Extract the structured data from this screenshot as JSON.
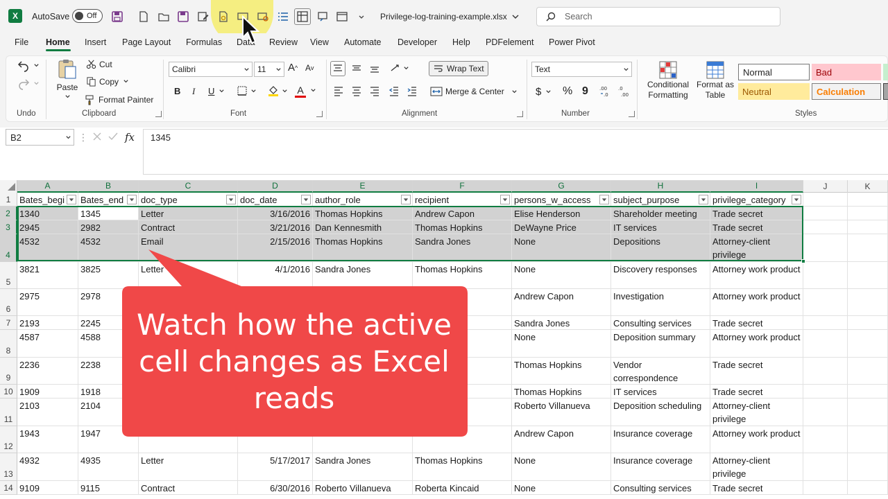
{
  "titlebar": {
    "autosave_label": "AutoSave",
    "autosave_state": "Off",
    "filename": "Privilege-log-training-example.xlsx",
    "search_placeholder": "Search"
  },
  "menu": [
    "File",
    "Home",
    "Insert",
    "Page Layout",
    "Formulas",
    "Data",
    "Review",
    "View",
    "Automate",
    "Developer",
    "Help",
    "PDFelement",
    "Power Pivot"
  ],
  "ribbon": {
    "undo_label": "Undo",
    "clipboard": {
      "paste": "Paste",
      "cut": "Cut",
      "copy": "Copy",
      "format_painter": "Format Painter",
      "label": "Clipboard"
    },
    "font": {
      "name": "Calibri",
      "size": "11",
      "bold": "B",
      "italic": "I",
      "underline": "U",
      "grow": "A",
      "shrink": "A",
      "color_letter": "A",
      "label": "Font"
    },
    "alignment": {
      "wrap_text": "Wrap Text",
      "merge_center": "Merge & Center",
      "label": "Alignment"
    },
    "number": {
      "format": "Text",
      "currency": "$",
      "percent": "%",
      "comma": "9",
      "label": "Number"
    },
    "styles": {
      "conditional_1": "Conditional",
      "conditional_2": "Formatting",
      "format_table_1": "Format as",
      "format_table_2": "Table",
      "normal": "Normal",
      "bad": "Bad",
      "neutral": "Neutral",
      "calculation": "Calculation",
      "label": "Styles"
    }
  },
  "formula_bar": {
    "name_box": "B2",
    "fx": "fx",
    "value": "1345"
  },
  "colors": {
    "excel_green": "#107c41",
    "callout_red": "#f04848",
    "highlight_yellow": "#f5ec64"
  },
  "sheet": {
    "columns": [
      "A",
      "B",
      "C",
      "D",
      "E",
      "F",
      "G",
      "H",
      "I",
      "J",
      "K"
    ],
    "headers": [
      "Bates_begi",
      "Bates_end",
      "doc_type",
      "doc_date",
      "author_role",
      "recipient",
      "persons_w_access",
      "subject_purpose",
      "privilege_category"
    ],
    "rows": [
      {
        "n": "2",
        "cells": [
          "1340",
          "1345",
          "Letter",
          "3/16/2016",
          "Thomas Hopkins",
          "Andrew Capon",
          "Elise Henderson",
          "Shareholder meeting",
          "Trade secret"
        ]
      },
      {
        "n": "3",
        "cells": [
          "2945",
          "2982",
          "Contract",
          "3/21/2016",
          "Dan Kennesmith",
          "Thomas Hopkins",
          "DeWayne Price",
          "IT services",
          "Trade secret"
        ]
      },
      {
        "n": "4",
        "cells": [
          "4532",
          "4532",
          "Email",
          "2/15/2016",
          "Thomas Hopkins",
          "Sandra Jones",
          "None",
          "Depositions",
          "Attorney-client privilege"
        ]
      },
      {
        "n": "5",
        "cells": [
          "3821",
          "3825",
          "Letter",
          "4/1/2016",
          "Sandra Jones",
          "Thomas Hopkins",
          "None",
          "Discovery responses",
          "Attorney work product"
        ]
      },
      {
        "n": "6",
        "cells": [
          "2975",
          "2978",
          "",
          "",
          "",
          "aid",
          "Andrew Capon",
          "Investigation",
          "Attorney work product"
        ]
      },
      {
        "n": "7",
        "cells": [
          "2193",
          "2245",
          "",
          "",
          "",
          "rson",
          "Sandra Jones",
          "Consulting services",
          "Trade secret"
        ]
      },
      {
        "n": "8",
        "cells": [
          "4587",
          "4588",
          "",
          "",
          "",
          "kins",
          "None",
          "Deposition summary",
          "Attorney work product"
        ]
      },
      {
        "n": "9",
        "cells": [
          "2236",
          "2238",
          "",
          "",
          "",
          "rson",
          "Thomas Hopkins",
          "Vendor correspondence",
          "Trade secret"
        ]
      },
      {
        "n": "10",
        "cells": [
          "1909",
          "1918",
          "",
          "",
          "",
          "kins",
          "Thomas Hopkins",
          "IT services",
          "Trade secret"
        ]
      },
      {
        "n": "11",
        "cells": [
          "2103",
          "2104",
          "",
          "",
          "",
          "rice",
          "Roberto Villanueva",
          "Deposition scheduling",
          "Attorney-client privilege"
        ]
      },
      {
        "n": "12",
        "cells": [
          "1943",
          "1947",
          "",
          "",
          "",
          "rice",
          "Andrew Capon",
          "Insurance coverage",
          "Attorney work product"
        ]
      },
      {
        "n": "13",
        "cells": [
          "4932",
          "4935",
          "Letter",
          "5/17/2017",
          "Sandra Jones",
          "Thomas Hopkins",
          "None",
          "Insurance coverage",
          "Attorney-client privilege"
        ]
      },
      {
        "n": "14",
        "cells": [
          "9109",
          "9115",
          "Contract",
          "6/30/2016",
          "Roberto Villanueva",
          "Roberta Kincaid",
          "None",
          "Consulting services",
          "Trade secret"
        ]
      }
    ]
  },
  "callout": {
    "text": "Watch how the active cell changes as Excel reads"
  }
}
